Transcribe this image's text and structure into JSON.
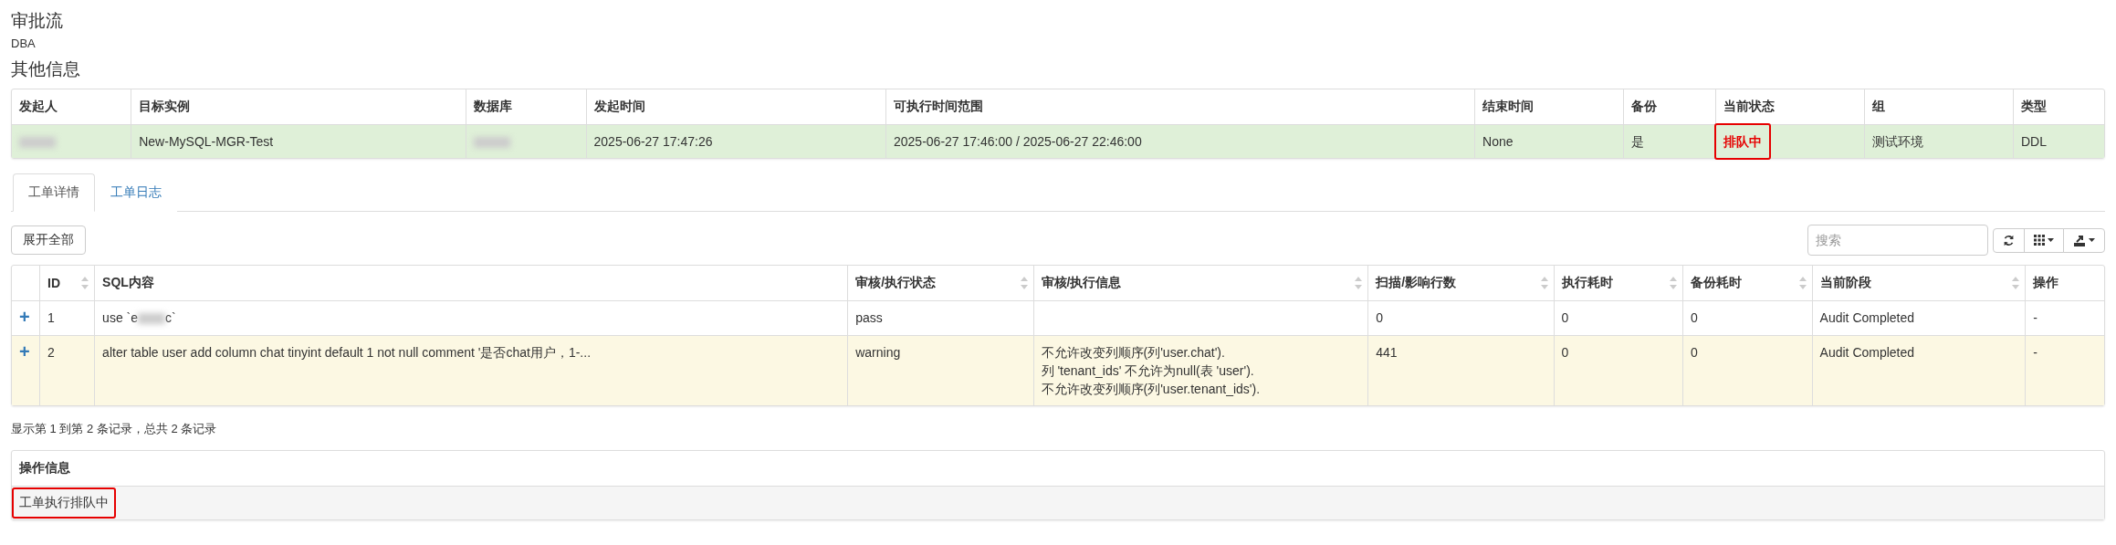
{
  "workflow": {
    "title": "审批流",
    "approver": "DBA"
  },
  "info": {
    "title": "其他信息",
    "columns": [
      {
        "label": "发起人"
      },
      {
        "label": "目标实例"
      },
      {
        "label": "数据库"
      },
      {
        "label": "发起时间"
      },
      {
        "label": "可执行时间范围"
      },
      {
        "label": "结束时间"
      },
      {
        "label": "备份"
      },
      {
        "label": "当前状态"
      },
      {
        "label": "组"
      },
      {
        "label": "类型"
      }
    ],
    "row": [
      {
        "kind": "redacted"
      },
      {
        "kind": "text",
        "text": "New-MySQL-MGR-Test"
      },
      {
        "kind": "redacted"
      },
      {
        "kind": "text",
        "text": "2025-06-27 17:47:26"
      },
      {
        "kind": "text",
        "text": "2025-06-27 17:46:00 / 2025-06-27 22:46:00"
      },
      {
        "kind": "text",
        "text": "None"
      },
      {
        "kind": "text",
        "text": "是"
      },
      {
        "kind": "status",
        "text": "排队中",
        "highlighted": true
      },
      {
        "kind": "text",
        "text": "测试环境"
      },
      {
        "kind": "text",
        "text": "DDL"
      }
    ]
  },
  "tabs": [
    {
      "label": "工单详情",
      "selected": true
    },
    {
      "label": "工单日志",
      "selected": false
    }
  ],
  "expand_button": "展开全部",
  "search": {
    "placeholder": "搜索"
  },
  "table": {
    "columns": [
      {
        "label": "ID",
        "sortable": true
      },
      {
        "label": "SQL内容",
        "sortable": false
      },
      {
        "label": "审核/执行状态",
        "sortable": true
      },
      {
        "label": "审核/执行信息",
        "sortable": true
      },
      {
        "label": "扫描/影响行数",
        "sortable": true
      },
      {
        "label": "执行耗时",
        "sortable": true
      },
      {
        "label": "备份耗时",
        "sortable": true
      },
      {
        "label": "当前阶段",
        "sortable": true
      },
      {
        "label": "操作",
        "sortable": false
      }
    ],
    "rows": [
      {
        "toggle": "+",
        "id": "1",
        "sql": "use `e",
        "sql_redacted": true,
        "sql_end": "c`",
        "status": "pass",
        "color": "#ffffff",
        "messages": [],
        "rows": "0",
        "exec_time": "0",
        "backup_time": "0",
        "stage": "Audit Completed",
        "action": "-"
      },
      {
        "toggle": "+",
        "id": "2",
        "sql": "alter table user add column chat tinyint default 1 not null comment '是否chat用户，1-...",
        "sql_redacted": false,
        "status": "warning",
        "color": "#fcf8e3",
        "messages": [
          "不允许改变列顺序(列'user.chat').",
          "列 'tenant_ids' 不允许为null(表 'user').",
          "不允许改变列顺序(列'user.tenant_ids')."
        ],
        "rows": "441",
        "exec_time": "0",
        "backup_time": "0",
        "stage": "Audit Completed",
        "action": "-"
      }
    ]
  },
  "pagination": "显示第 1 到第 2 条记录，总共 2 条记录",
  "operation": {
    "title": "操作信息",
    "message": "工单执行排队中",
    "highlighted": true
  }
}
